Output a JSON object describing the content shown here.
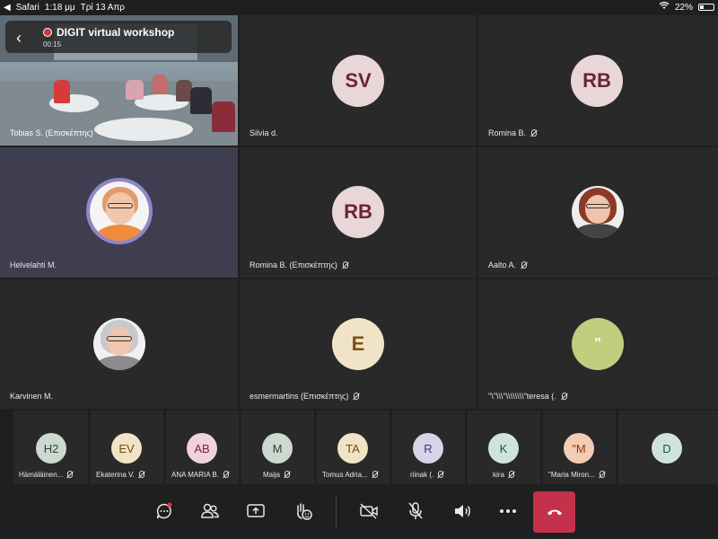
{
  "status_bar": {
    "app": "Safari",
    "time": "1:18 μμ",
    "date": "Τρί 13 Απρ",
    "battery": "22%",
    "dots": "• • •"
  },
  "meeting": {
    "title": "DIGIT virtual workshop",
    "elapsed": "00:15",
    "record_color": "#e0303a"
  },
  "main_tiles": [
    {
      "name": "Tobias S. (Επισκέπτης)",
      "type": "video",
      "muted": false
    },
    {
      "name": "Silvia d.",
      "initials": "SV",
      "bg": "#e8d6d9",
      "fg": "#6b2438",
      "muted": false
    },
    {
      "name": "Romina B.",
      "initials": "RB",
      "bg": "#e8d6d9",
      "fg": "#6b2438",
      "muted": true
    },
    {
      "name": "Helvelahti M.",
      "type": "photo",
      "muted": false,
      "active": true
    },
    {
      "name": "Romina B. (Επισκέπτης)",
      "initials": "RB",
      "bg": "#e8d6d9",
      "fg": "#6b2438",
      "muted": true
    },
    {
      "name": "Aalto A.",
      "type": "photo",
      "muted": true
    },
    {
      "name": "Karvinen M.",
      "type": "photo",
      "muted": false
    },
    {
      "name": "esmermartins (Επισκέπτης)",
      "initials": "E",
      "bg": "#f1e4c6",
      "fg": "#7a5414",
      "muted": true
    },
    {
      "name": "\"\\\"\\\\\\\"\\\\\\\\\\\\\\\\\"teresa (.",
      "initials": "\"",
      "bg": "#c0cf7e",
      "fg": "#ffffff",
      "muted": true
    }
  ],
  "strip": [
    {
      "name": "Hämäläinen...",
      "initials": "H2",
      "bg": "#cdd8d0",
      "fg": "#2d4436"
    },
    {
      "name": "Ekaterina V.",
      "initials": "EV",
      "bg": "#f1e4c6",
      "fg": "#6a4a12"
    },
    {
      "name": "ANA MARIA B.",
      "initials": "AB",
      "bg": "#efd3dc",
      "fg": "#7a2544"
    },
    {
      "name": "Maija",
      "initials": "M",
      "bg": "#cdd8d0",
      "fg": "#2d4436"
    },
    {
      "name": "Tomus Adria...",
      "initials": "TA",
      "bg": "#f1e4c6",
      "fg": "#6a4a12"
    },
    {
      "name": "riinak (.",
      "initials": "R",
      "bg": "#d6d4ea",
      "fg": "#3c3a6c"
    },
    {
      "name": "kira",
      "initials": "K",
      "bg": "#cfe3dc",
      "fg": "#1f5242"
    },
    {
      "name": "\"Maria Miron...",
      "initials": "\"M",
      "bg": "#f3cdb3",
      "fg": "#8a3a0e"
    },
    {
      "name": "",
      "initials": "D",
      "bg": "#cfe3dc",
      "fg": "#1f5242"
    }
  ],
  "toolbar": {
    "chat": "chat-icon",
    "participants": "participants-icon",
    "share": "share-screen-icon",
    "reactions": "raise-hand-icon",
    "camera": "camera-off-icon",
    "mic": "mic-off-icon",
    "speaker": "speaker-icon",
    "more": "more-icon",
    "hangup": "hang-up-icon",
    "hangup_color": "#c4314b"
  }
}
